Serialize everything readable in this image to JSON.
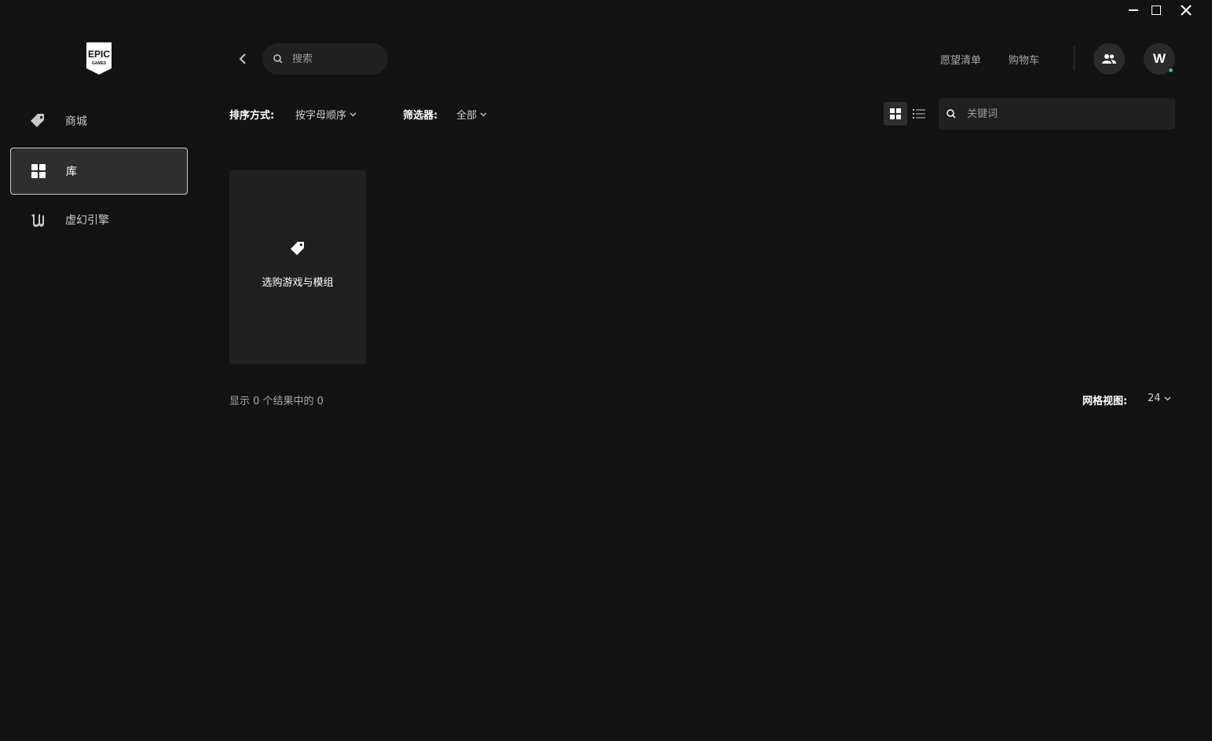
{
  "window": {
    "min_icon": "minimize-icon",
    "max_icon": "maximize-icon",
    "close_icon": "close-icon"
  },
  "logo": {
    "line1": "EPIC",
    "line2": "GAMES"
  },
  "sidebar": {
    "items": [
      {
        "label": "商城",
        "icon": "tag-icon",
        "active": false
      },
      {
        "label": "库",
        "icon": "grid-icon",
        "active": true
      },
      {
        "label": "虚幻引擎",
        "icon": "unreal-icon",
        "active": false
      }
    ]
  },
  "header": {
    "search_placeholder": "搜索",
    "wishlist": "愿望清单",
    "cart": "购物车",
    "avatar_letter": "W",
    "online_color": "#2fd15a"
  },
  "filters": {
    "sort_label": "排序方式:",
    "sort_value": "按字母顺序",
    "filter_label": "筛选器:",
    "filter_value": "全部",
    "keyword_placeholder": "关键词"
  },
  "library": {
    "card_label": "选购游戏与模组",
    "result_text": "显示 0 个结果中的 0",
    "grid_label": "网格视图:",
    "grid_value": "24"
  },
  "colors": {
    "background": "#121212",
    "surface": "#202020",
    "active_nav": "#2e2e2e"
  }
}
